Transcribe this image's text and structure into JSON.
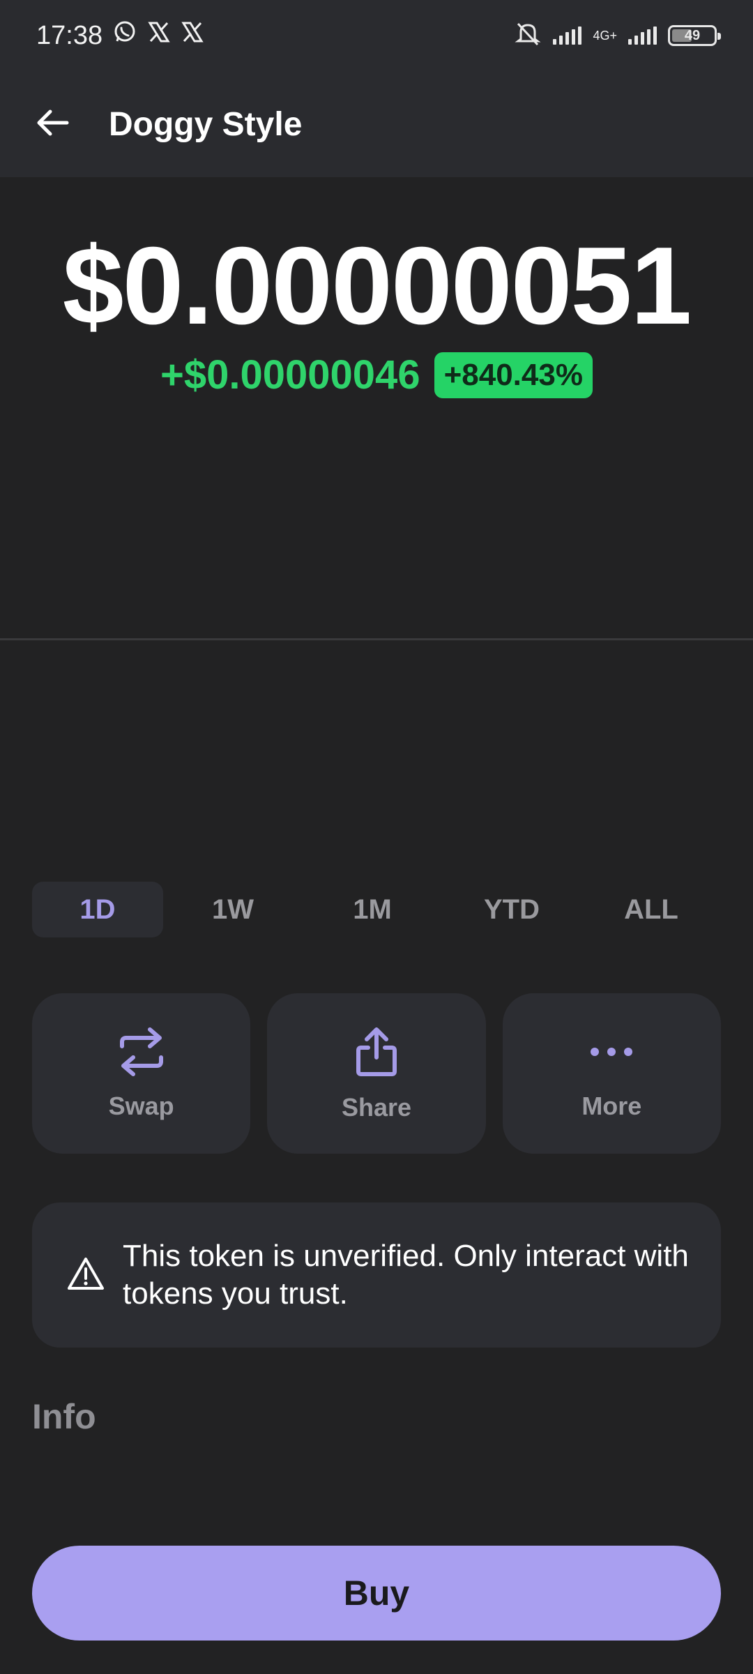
{
  "status_bar": {
    "time": "17:38",
    "network": "4G+",
    "battery": "49",
    "icons": [
      "whatsapp-icon",
      "x-icon",
      "x-icon",
      "bell-muted-icon",
      "signal-icon",
      "signal-icon"
    ]
  },
  "header": {
    "title": "Doggy Style",
    "back_icon": "arrow-left-icon"
  },
  "price": {
    "value": "$0.00000051",
    "change": "+$0.00000046",
    "change_percent": "+840.43%"
  },
  "colors": {
    "accent": "#a99ff0",
    "positive": "#25d366",
    "background": "#222223",
    "surface": "#2c2d32"
  },
  "ranges": {
    "items": [
      "1D",
      "1W",
      "1M",
      "YTD",
      "ALL"
    ],
    "selected": "1D"
  },
  "actions": [
    {
      "label": "Swap",
      "icon": "swap-icon"
    },
    {
      "label": "Share",
      "icon": "share-icon"
    },
    {
      "label": "More",
      "icon": "more-dots-icon"
    }
  ],
  "warning": {
    "text": "This token is unverified. Only interact with tokens you trust.",
    "icon": "warning-icon"
  },
  "info": {
    "heading": "Info"
  },
  "buy": {
    "label": "Buy"
  }
}
